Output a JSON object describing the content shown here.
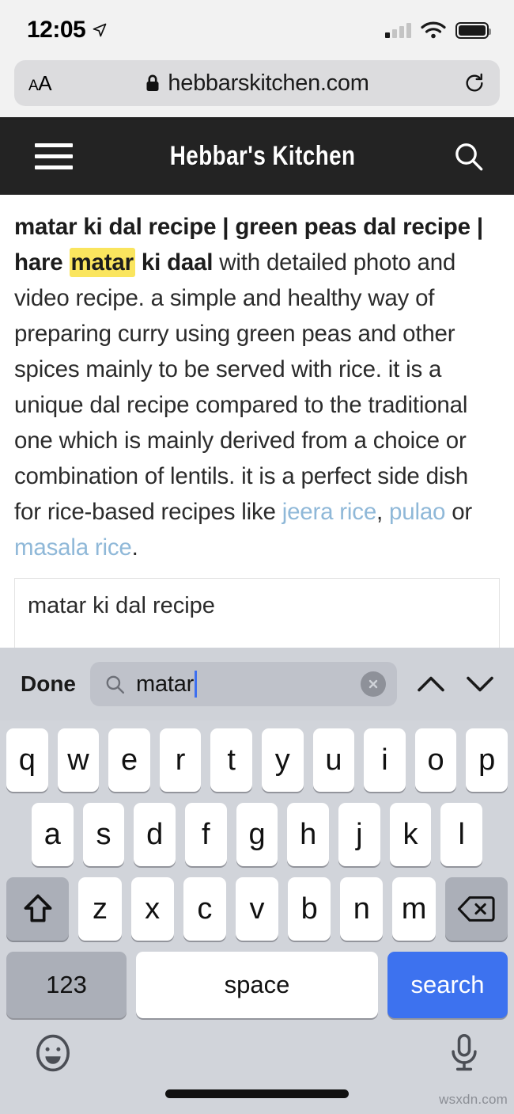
{
  "status_bar": {
    "time": "12:05",
    "location_icon": "location-arrow-icon",
    "signal_icon": "cellular-signal-icon",
    "wifi_icon": "wifi-icon",
    "battery_icon": "battery-full-icon"
  },
  "browser": {
    "text_size_label": "AA",
    "lock_icon": "lock-icon",
    "url": "hebbarskitchen.com",
    "reload_icon": "reload-icon"
  },
  "site_header": {
    "menu_icon": "hamburger-menu-icon",
    "logo": "Hebbar's Kitchen",
    "search_icon": "search-icon",
    "background": "#232323"
  },
  "article": {
    "bold_lead_1": "matar ki dal recipe | green peas dal recipe | hare ",
    "highlight_term": "matar",
    "bold_lead_2": " ki daal",
    "body_1": " with detailed photo and video recipe. a simple and healthy way of preparing curry using green peas and other spices mainly to be served with rice. it is a unique dal recipe compared to the traditional one which is mainly derived from a choice or combination of lentils. it is a perfect side dish for rice-based recipes like ",
    "link_1": "jeera rice",
    "sep_1": ", ",
    "link_2": "pulao",
    "sep_2": " or ",
    "link_3": "masala rice",
    "end": ".",
    "highlight_color": "#fae55e",
    "link_color": "#8fb8d8",
    "info_box_text": "matar ki dal recipe"
  },
  "find_bar": {
    "done_label": "Done",
    "search_icon": "search-icon",
    "query": "matar",
    "clear_icon": "clear-circle-icon",
    "previous_icon": "chevron-up-icon",
    "next_icon": "chevron-down-icon",
    "caret_color": "#3d6ff0",
    "background": "#cfd2d8"
  },
  "keyboard": {
    "row1": [
      "q",
      "w",
      "e",
      "r",
      "t",
      "y",
      "u",
      "i",
      "o",
      "p"
    ],
    "row2": [
      "a",
      "s",
      "d",
      "f",
      "g",
      "h",
      "j",
      "k",
      "l"
    ],
    "row3": [
      "z",
      "x",
      "c",
      "v",
      "b",
      "n",
      "m"
    ],
    "shift_icon": "shift-arrow-icon",
    "backspace_icon": "backspace-icon",
    "numbers_label": "123",
    "space_label": "space",
    "return_label": "search",
    "return_color": "#3d72ef",
    "emoji_icon": "emoji-smiley-icon",
    "mic_icon": "microphone-icon",
    "background": "#d1d4da"
  },
  "watermark": "wsxdn.com"
}
